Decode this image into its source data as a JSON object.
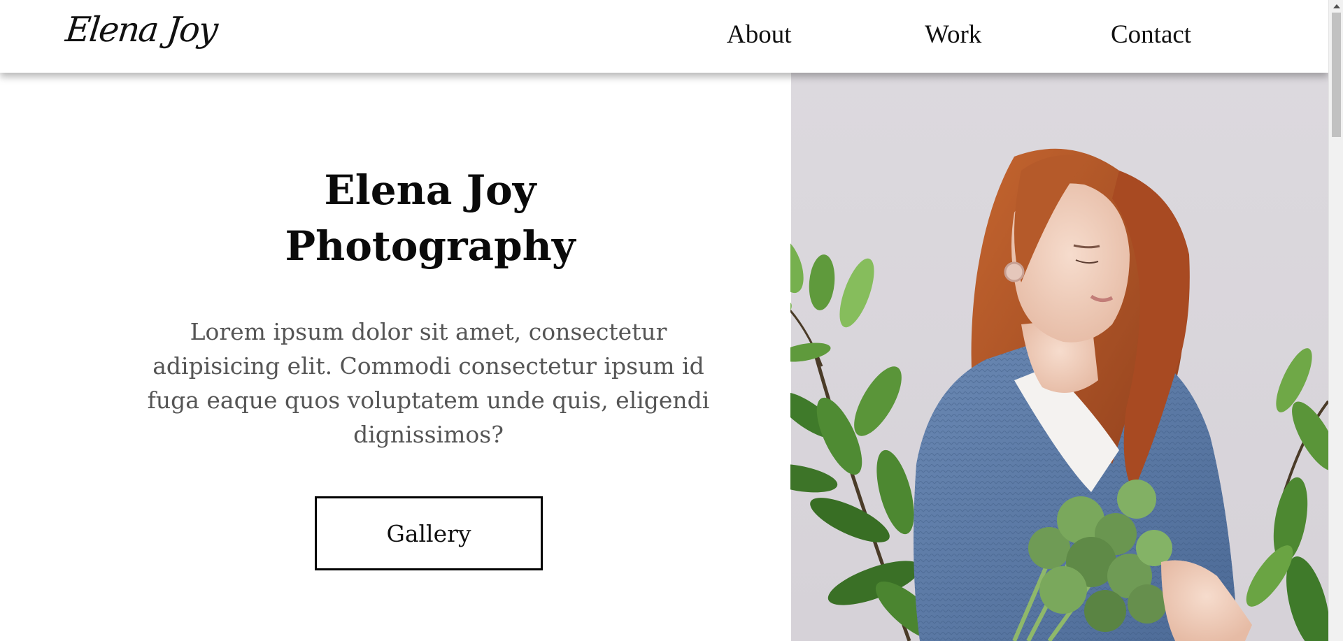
{
  "header": {
    "logo": "Elena Joy",
    "nav": {
      "about": "About",
      "work": "Work",
      "contact": "Contact"
    }
  },
  "hero": {
    "title_line1": "Elena Joy",
    "title_line2": "Photography",
    "text": "Lorem ipsum dolor sit amet, consectetur adipisicing elit. Commodi consectetur ipsum id fuga eaque quos voluptatem unde quis, eligendi dignissimos?",
    "button_label": "Gallery"
  },
  "colors": {
    "photo_background": "#dcd9de",
    "sweater": "#5b7aa6",
    "hair": "#b4572c",
    "leaves": "#5f9a3c",
    "body_text": "#555555"
  }
}
